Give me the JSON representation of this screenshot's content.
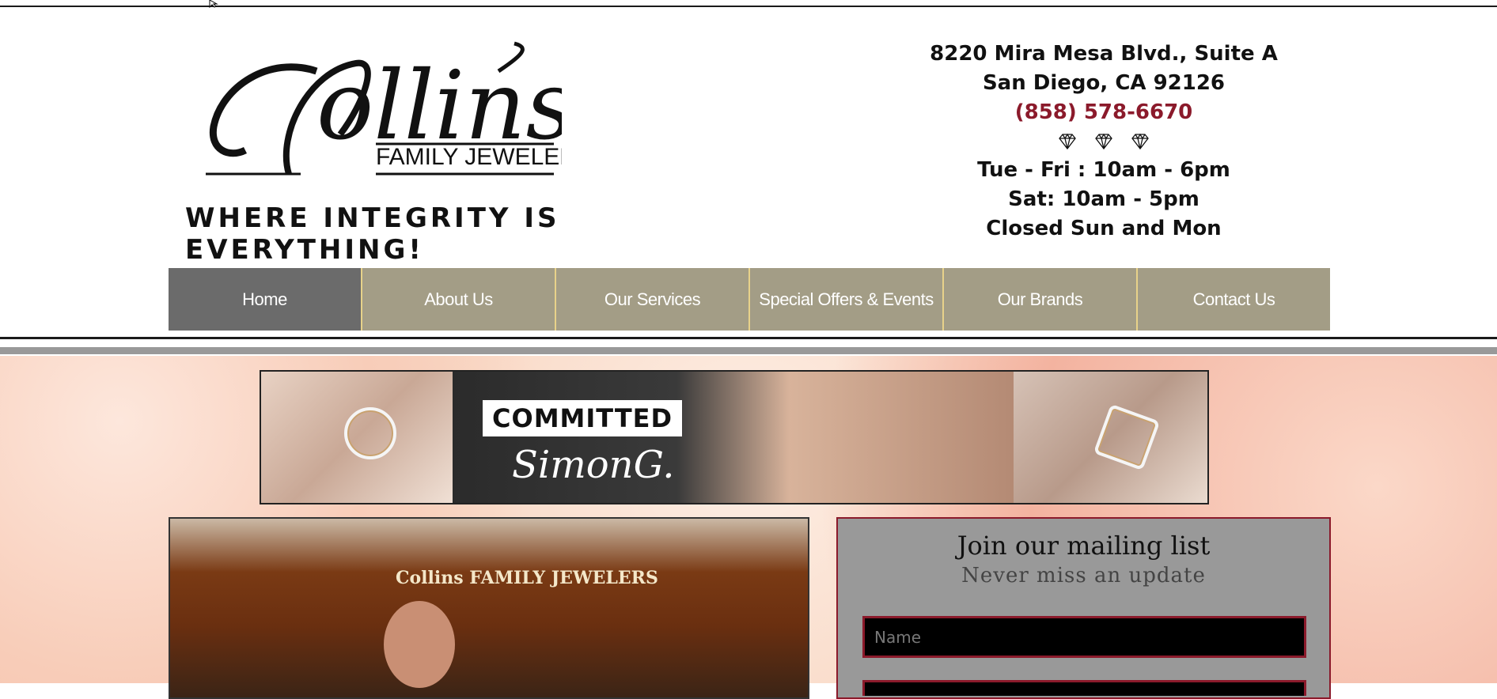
{
  "header": {
    "logo": {
      "script_text": "Collins",
      "sub_text": "FAMILY JEWELERS"
    },
    "tagline": "WHERE INTEGRITY IS EVERYTHING!",
    "address_line1": "8220 Mira Mesa Blvd., Suite A",
    "address_line2": "San Diego, CA 92126",
    "phone": "(858) 578-6670",
    "hours_line1": "Tue - Fri : 10am - 6pm",
    "hours_line2": "Sat: 10am - 5pm",
    "hours_line3": "Closed Sun and Mon"
  },
  "nav": {
    "items": [
      {
        "label": "Home",
        "active": true
      },
      {
        "label": "About Us",
        "active": false
      },
      {
        "label": "Our Services",
        "active": false
      },
      {
        "label": "Special Offers & Events",
        "active": false
      },
      {
        "label": "Our Brands",
        "active": false
      },
      {
        "label": "Contact Us",
        "active": false
      }
    ]
  },
  "banner": {
    "headline": "COMMITTED",
    "brand": "SimonG."
  },
  "photo": {
    "sign_text": "Collins FAMILY JEWELERS"
  },
  "mailing": {
    "title": "Join our mailing list",
    "subtitle": "Never miss an update",
    "name_placeholder": "Name"
  },
  "colors": {
    "nav_bg": "#a39d86",
    "nav_active_bg": "#6b6b6b",
    "phone": "#8b1a2b",
    "mailing_bg": "#999999"
  }
}
